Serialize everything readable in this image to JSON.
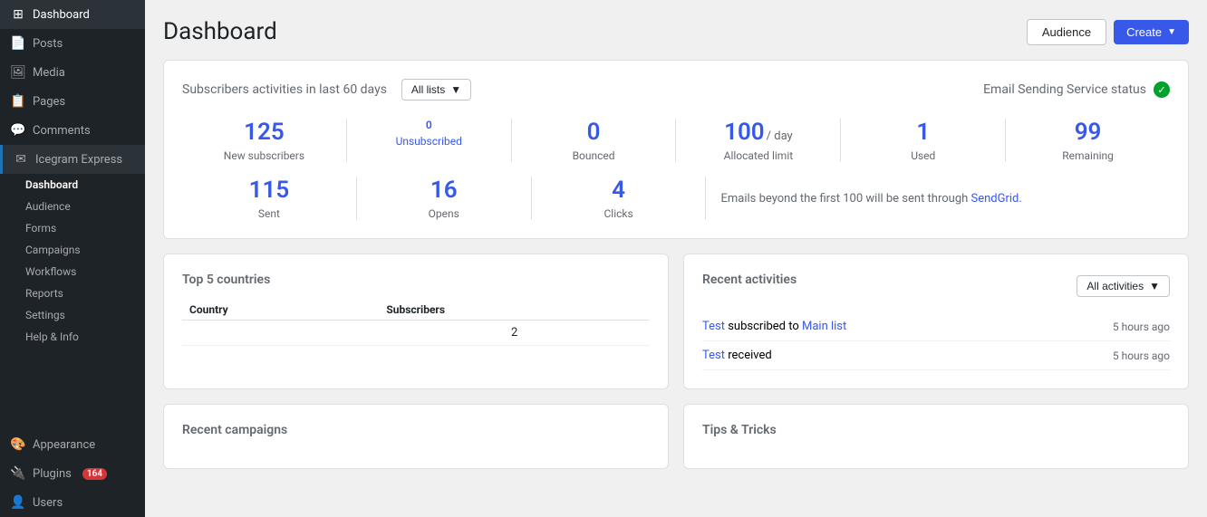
{
  "sidebar": {
    "items": [
      {
        "label": "Dashboard",
        "icon": "⊞",
        "name": "dashboard",
        "active": false
      },
      {
        "label": "Posts",
        "icon": "📄",
        "name": "posts",
        "active": false
      },
      {
        "label": "Media",
        "icon": "🖼",
        "name": "media",
        "active": false
      },
      {
        "label": "Pages",
        "icon": "📋",
        "name": "pages",
        "active": false
      },
      {
        "label": "Comments",
        "icon": "💬",
        "name": "comments",
        "active": false
      },
      {
        "label": "Icegram Express",
        "icon": "✉",
        "name": "icegram-express",
        "active": true,
        "highlight": true
      }
    ],
    "sub_items": [
      {
        "label": "Dashboard",
        "name": "sub-dashboard",
        "active": true
      },
      {
        "label": "Audience",
        "name": "sub-audience"
      },
      {
        "label": "Forms",
        "name": "sub-forms"
      },
      {
        "label": "Campaigns",
        "name": "sub-campaigns"
      },
      {
        "label": "Workflows",
        "name": "sub-workflows"
      },
      {
        "label": "Reports",
        "name": "sub-reports"
      },
      {
        "label": "Settings",
        "name": "sub-settings"
      },
      {
        "label": "Help & Info",
        "name": "sub-help"
      }
    ],
    "bottom_items": [
      {
        "label": "Appearance",
        "icon": "🎨",
        "name": "appearance"
      },
      {
        "label": "Plugins",
        "icon": "🔌",
        "name": "plugins",
        "badge": "164"
      },
      {
        "label": "Users",
        "icon": "👤",
        "name": "users"
      }
    ]
  },
  "header": {
    "title": "Dashboard",
    "audience_label": "Audience",
    "create_label": "Create"
  },
  "stats_card": {
    "title": "Subscribers activities in last 60 days",
    "dropdown_label": "All lists",
    "email_service_title": "Email Sending Service status",
    "stats": [
      {
        "number": "125",
        "label": "New subscribers",
        "link": false
      },
      {
        "number": "0",
        "label": "Unsubscribed",
        "link": true
      },
      {
        "number": "0",
        "label": "Bounced",
        "link": false
      },
      {
        "number": "100",
        "unit": "/ day",
        "label": "Allocated limit",
        "link": false
      },
      {
        "number": "1",
        "label": "Used",
        "link": false
      },
      {
        "number": "99",
        "label": "Remaining",
        "link": false
      }
    ],
    "row2_stats": [
      {
        "number": "115",
        "label": "Sent"
      },
      {
        "number": "16",
        "label": "Opens"
      },
      {
        "number": "4",
        "label": "Clicks"
      }
    ],
    "sendgrid_note": "Emails beyond the first 100 will be sent through",
    "sendgrid_link": "SendGrid."
  },
  "countries_section": {
    "title": "Top 5 countries",
    "col_country": "Country",
    "col_subscribers": "Subscribers",
    "rows": [
      {
        "country": "",
        "subscribers": "2"
      }
    ]
  },
  "activities_section": {
    "title": "Recent activities",
    "dropdown_label": "All activities",
    "activities": [
      {
        "text_parts": [
          "Test",
          " subscribed to ",
          "Main list"
        ],
        "links": [
          0,
          2
        ],
        "time": "5 hours ago"
      },
      {
        "text_parts": [
          "Test",
          " received"
        ],
        "links": [
          0
        ],
        "time": "5 hours ago"
      }
    ]
  },
  "recent_campaigns": {
    "title": "Recent campaigns"
  },
  "tips": {
    "title": "Tips & Tricks"
  }
}
